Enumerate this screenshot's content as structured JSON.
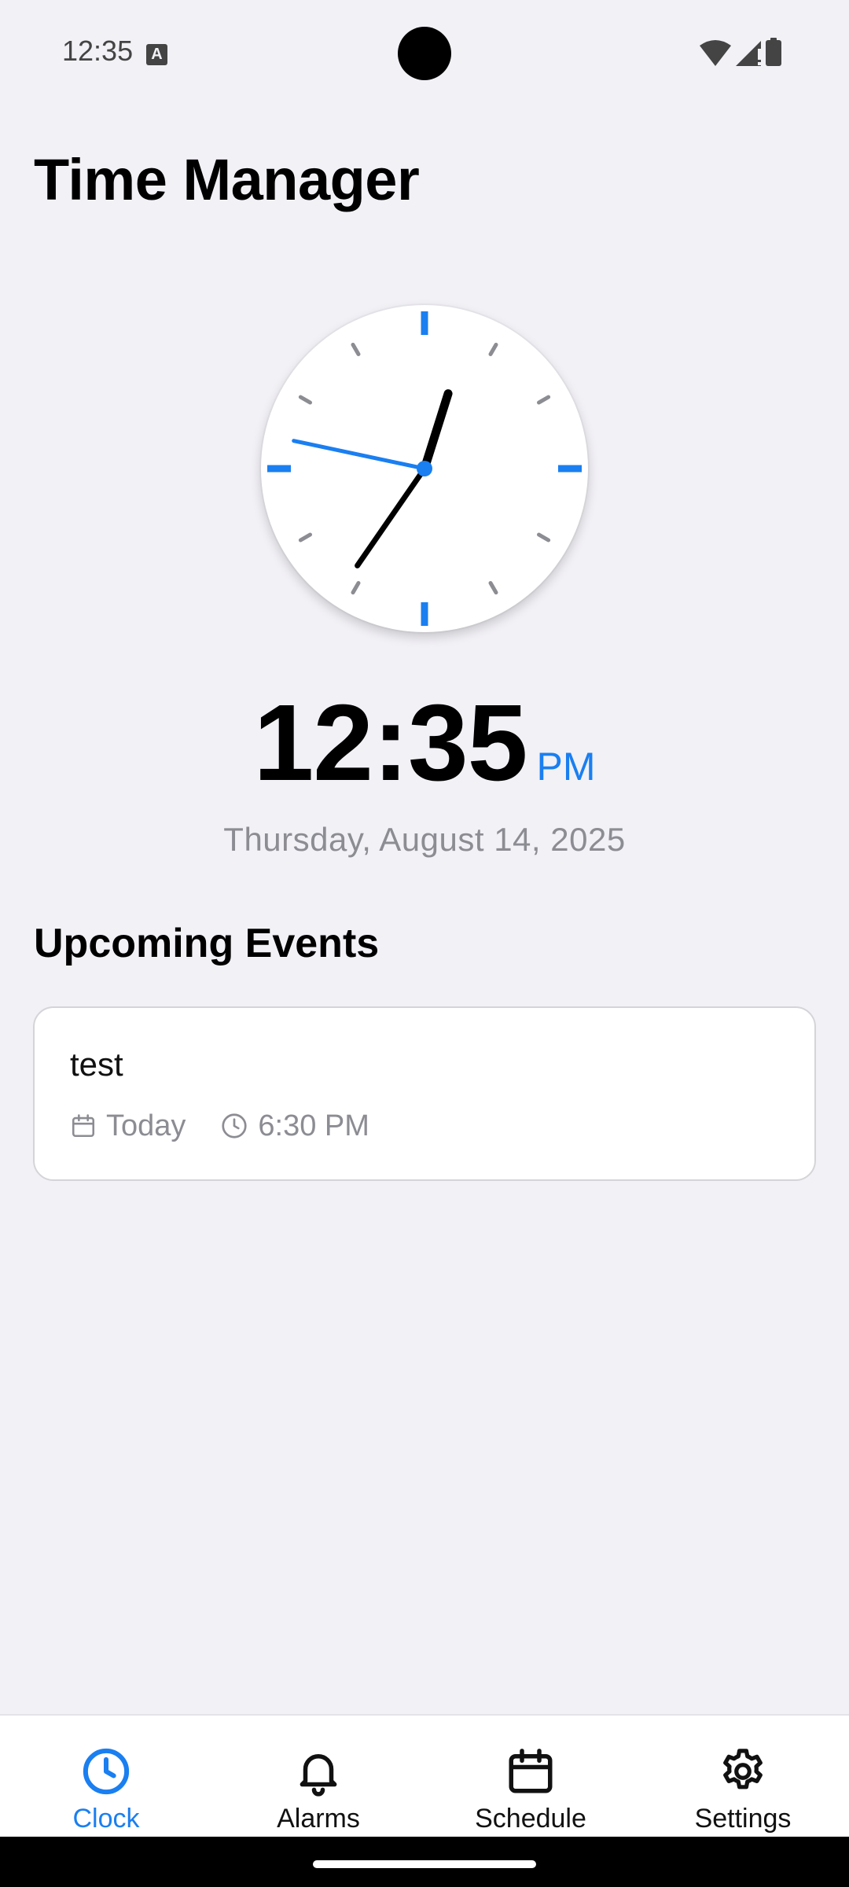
{
  "status_bar": {
    "time": "12:35",
    "icons": [
      "text-a-icon",
      "wifi-icon",
      "signal-icon",
      "battery-icon"
    ]
  },
  "app": {
    "title": "Time Manager"
  },
  "clock": {
    "hour": 12,
    "minute": 35,
    "second": 47,
    "colors": {
      "accent": "#1a7ff0",
      "hand": "#000000",
      "tick": "#8c8c93"
    }
  },
  "digital": {
    "time": "12:35",
    "period": "PM",
    "date": "Thursday, August 14, 2025"
  },
  "events": {
    "section_title": "Upcoming Events",
    "items": [
      {
        "title": "test",
        "day": "Today",
        "time": "6:30 PM"
      }
    ]
  },
  "tabs": [
    {
      "label": "Clock",
      "icon": "clock-icon",
      "active": true
    },
    {
      "label": "Alarms",
      "icon": "bell-icon",
      "active": false
    },
    {
      "label": "Schedule",
      "icon": "calendar-icon",
      "active": false
    },
    {
      "label": "Settings",
      "icon": "gear-icon",
      "active": false
    }
  ]
}
